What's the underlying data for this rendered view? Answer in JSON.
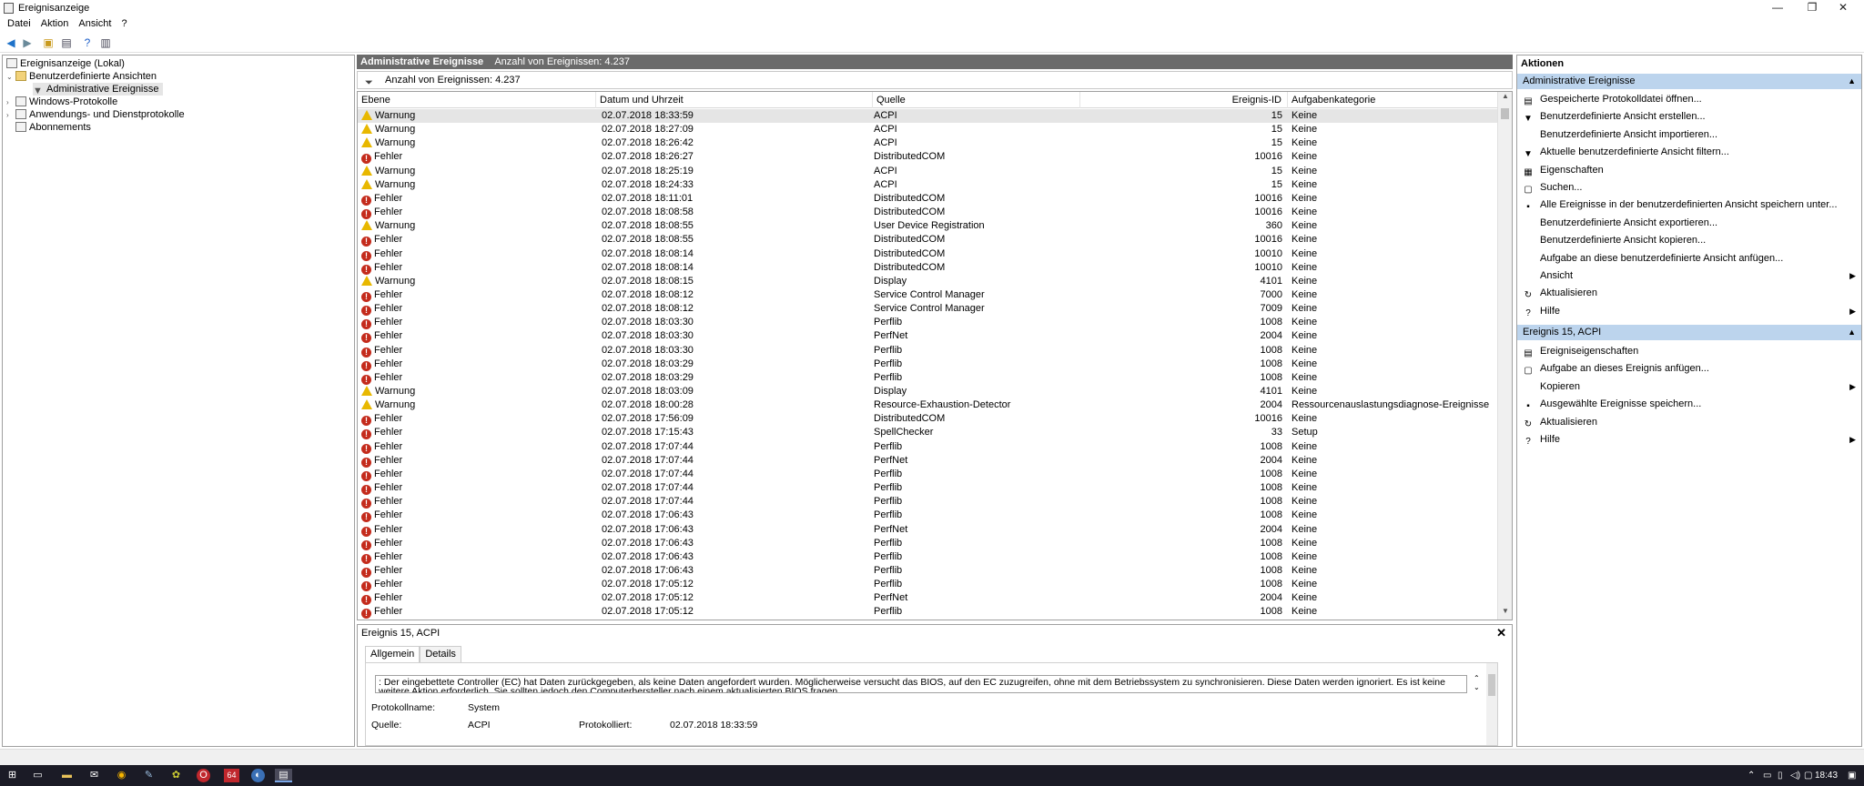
{
  "window": {
    "title": "Ereignisanzeige",
    "minimize": "—",
    "restore": "❐",
    "close": "✕"
  },
  "menu": [
    "Datei",
    "Aktion",
    "Ansicht",
    "?"
  ],
  "tree": {
    "root": "Ereignisanzeige (Lokal)",
    "custom_views": "Benutzerdefinierte Ansichten",
    "admin_events": "Administrative Ereignisse",
    "windows_logs": "Windows-Protokolle",
    "app_logs": "Anwendungs- und Dienstprotokolle",
    "subscriptions": "Abonnements"
  },
  "center": {
    "header_title": "Administrative Ereignisse",
    "header_count": "Anzahl von Ereignissen: 4.237",
    "filter_text": "Anzahl von Ereignissen: 4.237"
  },
  "columns": {
    "level": "Ebene",
    "date": "Datum und Uhrzeit",
    "source": "Quelle",
    "id": "Ereignis-ID",
    "category": "Aufgabenkategorie"
  },
  "events": [
    {
      "level": "Warnung",
      "type": "warn",
      "date": "02.07.2018 18:33:59",
      "source": "ACPI",
      "id": "15",
      "category": "Keine"
    },
    {
      "level": "Warnung",
      "type": "warn",
      "date": "02.07.2018 18:27:09",
      "source": "ACPI",
      "id": "15",
      "category": "Keine"
    },
    {
      "level": "Warnung",
      "type": "warn",
      "date": "02.07.2018 18:26:42",
      "source": "ACPI",
      "id": "15",
      "category": "Keine"
    },
    {
      "level": "Fehler",
      "type": "err",
      "date": "02.07.2018 18:26:27",
      "source": "DistributedCOM",
      "id": "10016",
      "category": "Keine"
    },
    {
      "level": "Warnung",
      "type": "warn",
      "date": "02.07.2018 18:25:19",
      "source": "ACPI",
      "id": "15",
      "category": "Keine"
    },
    {
      "level": "Warnung",
      "type": "warn",
      "date": "02.07.2018 18:24:33",
      "source": "ACPI",
      "id": "15",
      "category": "Keine"
    },
    {
      "level": "Fehler",
      "type": "err",
      "date": "02.07.2018 18:11:01",
      "source": "DistributedCOM",
      "id": "10016",
      "category": "Keine"
    },
    {
      "level": "Fehler",
      "type": "err",
      "date": "02.07.2018 18:08:58",
      "source": "DistributedCOM",
      "id": "10016",
      "category": "Keine"
    },
    {
      "level": "Warnung",
      "type": "warn",
      "date": "02.07.2018 18:08:55",
      "source": "User Device Registration",
      "id": "360",
      "category": "Keine"
    },
    {
      "level": "Fehler",
      "type": "err",
      "date": "02.07.2018 18:08:55",
      "source": "DistributedCOM",
      "id": "10016",
      "category": "Keine"
    },
    {
      "level": "Fehler",
      "type": "err",
      "date": "02.07.2018 18:08:14",
      "source": "DistributedCOM",
      "id": "10010",
      "category": "Keine"
    },
    {
      "level": "Fehler",
      "type": "err",
      "date": "02.07.2018 18:08:14",
      "source": "DistributedCOM",
      "id": "10010",
      "category": "Keine"
    },
    {
      "level": "Warnung",
      "type": "warn",
      "date": "02.07.2018 18:08:15",
      "source": "Display",
      "id": "4101",
      "category": "Keine"
    },
    {
      "level": "Fehler",
      "type": "err",
      "date": "02.07.2018 18:08:12",
      "source": "Service Control Manager",
      "id": "7000",
      "category": "Keine"
    },
    {
      "level": "Fehler",
      "type": "err",
      "date": "02.07.2018 18:08:12",
      "source": "Service Control Manager",
      "id": "7009",
      "category": "Keine"
    },
    {
      "level": "Fehler",
      "type": "err",
      "date": "02.07.2018 18:03:30",
      "source": "Perflib",
      "id": "1008",
      "category": "Keine"
    },
    {
      "level": "Fehler",
      "type": "err",
      "date": "02.07.2018 18:03:30",
      "source": "PerfNet",
      "id": "2004",
      "category": "Keine"
    },
    {
      "level": "Fehler",
      "type": "err",
      "date": "02.07.2018 18:03:30",
      "source": "Perflib",
      "id": "1008",
      "category": "Keine"
    },
    {
      "level": "Fehler",
      "type": "err",
      "date": "02.07.2018 18:03:29",
      "source": "Perflib",
      "id": "1008",
      "category": "Keine"
    },
    {
      "level": "Fehler",
      "type": "err",
      "date": "02.07.2018 18:03:29",
      "source": "Perflib",
      "id": "1008",
      "category": "Keine"
    },
    {
      "level": "Warnung",
      "type": "warn",
      "date": "02.07.2018 18:03:09",
      "source": "Display",
      "id": "4101",
      "category": "Keine"
    },
    {
      "level": "Warnung",
      "type": "warn",
      "date": "02.07.2018 18:00:28",
      "source": "Resource-Exhaustion-Detector",
      "id": "2004",
      "category": "Ressourcenauslastungsdiagnose-Ereignisse"
    },
    {
      "level": "Fehler",
      "type": "err",
      "date": "02.07.2018 17:56:09",
      "source": "DistributedCOM",
      "id": "10016",
      "category": "Keine"
    },
    {
      "level": "Fehler",
      "type": "err",
      "date": "02.07.2018 17:15:43",
      "source": "SpellChecker",
      "id": "33",
      "category": "Setup"
    },
    {
      "level": "Fehler",
      "type": "err",
      "date": "02.07.2018 17:07:44",
      "source": "Perflib",
      "id": "1008",
      "category": "Keine"
    },
    {
      "level": "Fehler",
      "type": "err",
      "date": "02.07.2018 17:07:44",
      "source": "PerfNet",
      "id": "2004",
      "category": "Keine"
    },
    {
      "level": "Fehler",
      "type": "err",
      "date": "02.07.2018 17:07:44",
      "source": "Perflib",
      "id": "1008",
      "category": "Keine"
    },
    {
      "level": "Fehler",
      "type": "err",
      "date": "02.07.2018 17:07:44",
      "source": "Perflib",
      "id": "1008",
      "category": "Keine"
    },
    {
      "level": "Fehler",
      "type": "err",
      "date": "02.07.2018 17:07:44",
      "source": "Perflib",
      "id": "1008",
      "category": "Keine"
    },
    {
      "level": "Fehler",
      "type": "err",
      "date": "02.07.2018 17:06:43",
      "source": "Perflib",
      "id": "1008",
      "category": "Keine"
    },
    {
      "level": "Fehler",
      "type": "err",
      "date": "02.07.2018 17:06:43",
      "source": "PerfNet",
      "id": "2004",
      "category": "Keine"
    },
    {
      "level": "Fehler",
      "type": "err",
      "date": "02.07.2018 17:06:43",
      "source": "Perflib",
      "id": "1008",
      "category": "Keine"
    },
    {
      "level": "Fehler",
      "type": "err",
      "date": "02.07.2018 17:06:43",
      "source": "Perflib",
      "id": "1008",
      "category": "Keine"
    },
    {
      "level": "Fehler",
      "type": "err",
      "date": "02.07.2018 17:06:43",
      "source": "Perflib",
      "id": "1008",
      "category": "Keine"
    },
    {
      "level": "Fehler",
      "type": "err",
      "date": "02.07.2018 17:05:12",
      "source": "Perflib",
      "id": "1008",
      "category": "Keine"
    },
    {
      "level": "Fehler",
      "type": "err",
      "date": "02.07.2018 17:05:12",
      "source": "PerfNet",
      "id": "2004",
      "category": "Keine"
    },
    {
      "level": "Fehler",
      "type": "err",
      "date": "02.07.2018 17:05:12",
      "source": "Perflib",
      "id": "1008",
      "category": "Keine"
    }
  ],
  "detail": {
    "title": "Ereignis 15, ACPI",
    "tab_general": "Allgemein",
    "tab_details": "Details",
    "message": ": Der eingebettete Controller (EC) hat Daten zurückgegeben, als keine Daten angefordert wurden. Möglicherweise versucht das BIOS, auf den EC zuzugreifen, ohne mit dem Betriebssystem zu synchronisieren. Diese Daten werden ignoriert. Es ist keine weitere Aktion erforderlich. Sie sollten jedoch den Computerhersteller nach einem aktualisierten BIOS fragen.",
    "log_label": "Protokollname:",
    "log_value": "System",
    "source_label": "Quelle:",
    "source_value": "ACPI",
    "logged_label": "Protokolliert:",
    "logged_value": "02.07.2018 18:33:59"
  },
  "actions": {
    "header": "Aktionen",
    "section1": "Administrative Ereignisse",
    "items1": [
      "Gespeicherte Protokolldatei öffnen...",
      "Benutzerdefinierte Ansicht erstellen...",
      "Benutzerdefinierte Ansicht importieren...",
      "Aktuelle benutzerdefinierte Ansicht filtern...",
      "Eigenschaften",
      "Suchen...",
      "Alle Ereignisse in der benutzerdefinierten Ansicht speichern unter...",
      "Benutzerdefinierte Ansicht exportieren...",
      "Benutzerdefinierte Ansicht kopieren...",
      "Aufgabe an diese benutzerdefinierte Ansicht anfügen...",
      "Ansicht",
      "Aktualisieren",
      "Hilfe"
    ],
    "section2": "Ereignis 15, ACPI",
    "items2": [
      "Ereigniseigenschaften",
      "Aufgabe an dieses Ereignis anfügen...",
      "Kopieren",
      "Ausgewählte Ereignisse speichern...",
      "Aktualisieren",
      "Hilfe"
    ]
  },
  "taskbar": {
    "badge": "64",
    "clock": "18:43"
  }
}
